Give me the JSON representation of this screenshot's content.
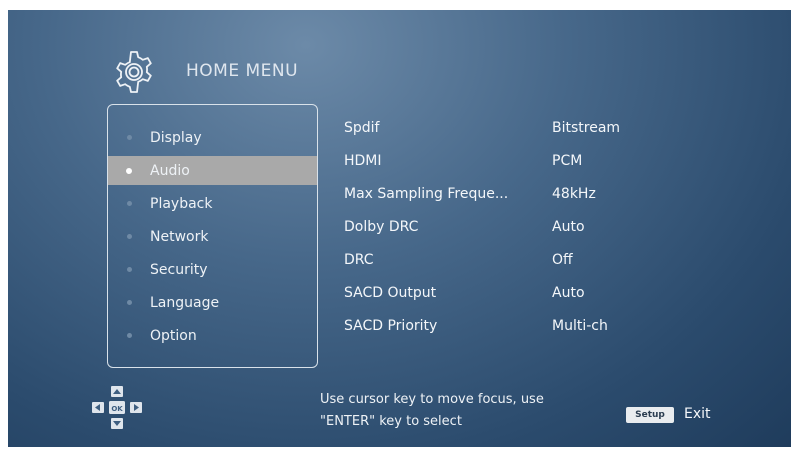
{
  "header": {
    "icon": "gear-icon",
    "title": "HOME MENU"
  },
  "sidebar": {
    "items": [
      {
        "label": "Display",
        "selected": false
      },
      {
        "label": "Audio",
        "selected": true
      },
      {
        "label": "Playback",
        "selected": false
      },
      {
        "label": "Network",
        "selected": false
      },
      {
        "label": "Security",
        "selected": false
      },
      {
        "label": "Language",
        "selected": false
      },
      {
        "label": "Option",
        "selected": false
      }
    ]
  },
  "settings": [
    {
      "name": "Spdif",
      "value": "Bitstream"
    },
    {
      "name": "HDMI",
      "value": "PCM"
    },
    {
      "name": "Max Sampling Freque...",
      "value": "48kHz"
    },
    {
      "name": "Dolby DRC",
      "value": "Auto"
    },
    {
      "name": "DRC",
      "value": "Off"
    },
    {
      "name": "SACD Output",
      "value": "Auto"
    },
    {
      "name": "SACD Priority",
      "value": "Multi-ch"
    }
  ],
  "footer": {
    "dpad_icon": "dpad-icon",
    "dpad_center": "OK",
    "hint_line1": "Use cursor key to move focus, use",
    "hint_line2": "\"ENTER\" key to select",
    "setup_key": "Setup",
    "exit_label": "Exit"
  },
  "colors": {
    "background": "#2b4b6d",
    "selected_row": "#a9a9a9",
    "text": "#f4f7fa"
  }
}
